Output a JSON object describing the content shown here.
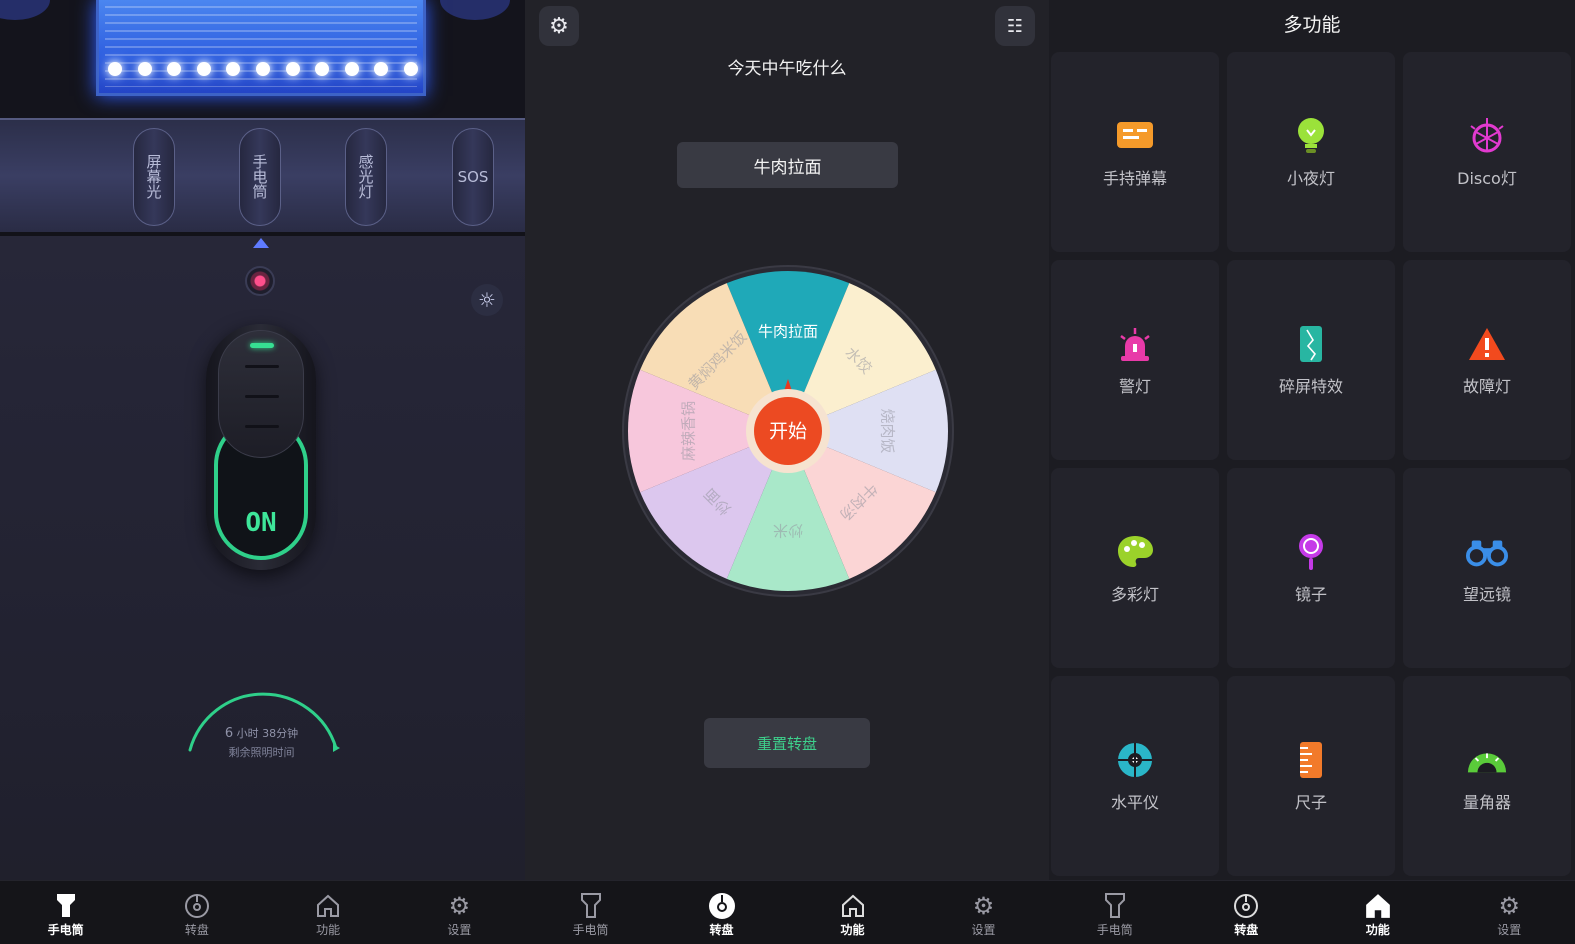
{
  "flashlight": {
    "modes": [
      "屏幕光",
      "手电筒",
      "感光灯",
      "SOS"
    ],
    "active_mode": "手电筒",
    "switch_state": "ON",
    "battery": {
      "hours": "6",
      "hours_unit": "小时",
      "minutes_text": "38分钟",
      "caption": "剩余照明时间",
      "level": 0.85
    }
  },
  "wheel_panel": {
    "title": "今天中午吃什么",
    "result": "牛肉拉面",
    "start_label": "开始",
    "reset_label": "重置转盘",
    "segments": [
      {
        "label": "牛肉拉面",
        "color": "#1fa9b8"
      },
      {
        "label": "水饺",
        "color": "#fbefcf"
      },
      {
        "label": "烧肉饭",
        "color": "#dfe0f3"
      },
      {
        "label": "牛肉汤",
        "color": "#fbd5d5"
      },
      {
        "label": "炒米",
        "color": "#a9e8c9"
      },
      {
        "label": "炒面",
        "color": "#dcc7ee"
      },
      {
        "label": "麻辣香锅",
        "color": "#f7c7dc"
      },
      {
        "label": "黄焖鸡米饭",
        "color": "#f8ddb6"
      }
    ]
  },
  "features": {
    "title": "多功能",
    "items": [
      {
        "label": "手持弹幕",
        "icon": "barrage-icon",
        "color": "#f59a2a"
      },
      {
        "label": "小夜灯",
        "icon": "bulb-icon",
        "color": "#9be23a"
      },
      {
        "label": "Disco灯",
        "icon": "disco-ball-icon",
        "color": "#e23ad0"
      },
      {
        "label": "警灯",
        "icon": "siren-icon",
        "color": "#e83aa8"
      },
      {
        "label": "碎屏特效",
        "icon": "cracked-phone-icon",
        "color": "#28b6a2"
      },
      {
        "label": "故障灯",
        "icon": "warning-icon",
        "color": "#f24a1e"
      },
      {
        "label": "多彩灯",
        "icon": "palette-icon",
        "color": "#9bd22a"
      },
      {
        "label": "镜子",
        "icon": "mirror-icon",
        "color": "#c53ae8"
      },
      {
        "label": "望远镜",
        "icon": "binoculars-icon",
        "color": "#3a8ee8"
      },
      {
        "label": "水平仪",
        "icon": "level-icon",
        "color": "#2ab6c8"
      },
      {
        "label": "尺子",
        "icon": "ruler-icon",
        "color": "#f27a2a"
      },
      {
        "label": "量角器",
        "icon": "protractor-icon",
        "color": "#5acb3a"
      }
    ]
  },
  "nav": {
    "items": [
      "手电筒",
      "转盘",
      "功能",
      "设置"
    ],
    "active": [
      "手电筒",
      "转盘",
      "功能"
    ]
  }
}
